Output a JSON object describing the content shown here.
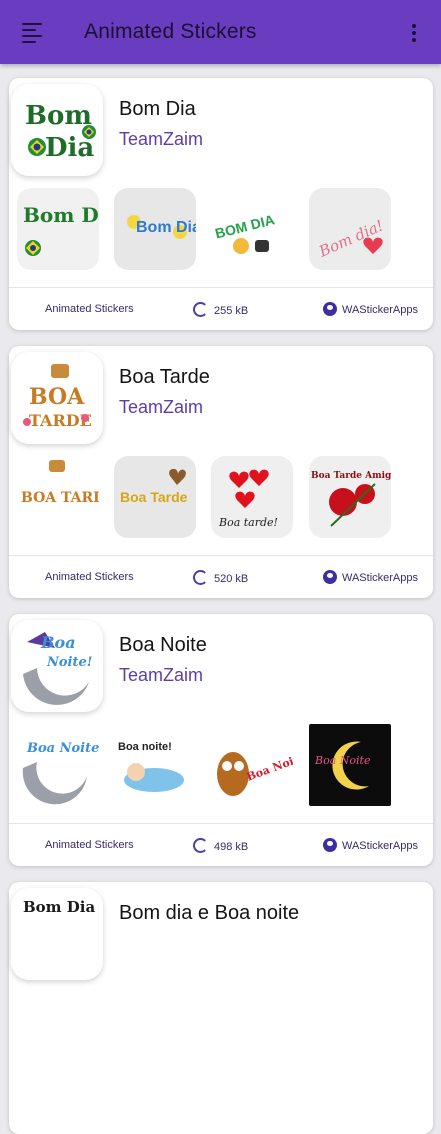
{
  "appbar": {
    "title": "Animated Stickers",
    "menu_icon": "hamburger-icon",
    "more_icon": "more-vert-icon",
    "color": "#6a3cc0"
  },
  "packs": [
    {
      "name": "Bom Dia",
      "author": "TeamZaim",
      "category": "Animated Stickers",
      "size": "255 kB",
      "publisher": "WAStickerApps",
      "tray_text": [
        "Bom",
        "Dia"
      ],
      "sticker_texts": [
        "Bom Dia",
        "Bom Dia",
        "BOM DIA",
        "Bom dia!"
      ]
    },
    {
      "name": "Boa Tarde",
      "author": "TeamZaim",
      "category": "Animated Stickers",
      "size": "520 kB",
      "publisher": "WAStickerApps",
      "tray_text": [
        "BOA",
        "TARDE"
      ],
      "sticker_texts": [
        "BOA TARDE",
        "Boa Tarde",
        "Boa tarde!",
        "Boa Tarde Amigos"
      ]
    },
    {
      "name": "Boa Noite",
      "author": "TeamZaim",
      "category": "Animated Stickers",
      "size": "498 kB",
      "publisher": "WAStickerApps",
      "tray_text": [
        "Boa",
        "Noite!"
      ],
      "sticker_texts": [
        "Boa Noite!",
        "Boa noite!",
        "Boa Noite!",
        "Boa Noite"
      ]
    },
    {
      "name": "Bom dia e Boa noite",
      "tray_text": [
        "Bom Dia",
        ""
      ]
    }
  ]
}
